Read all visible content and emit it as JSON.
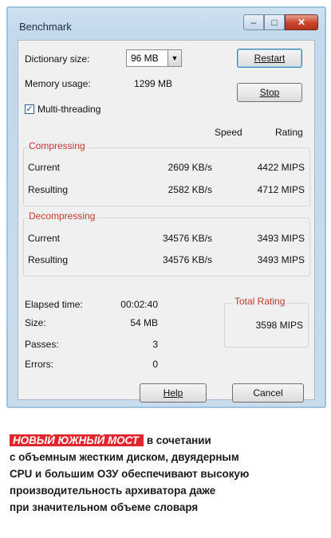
{
  "window": {
    "title": "Benchmark",
    "controls": [
      "minimize",
      "maximize",
      "close"
    ]
  },
  "form": {
    "dictionary_label": "Dictionary size:",
    "dictionary_value": "96 MB",
    "memory_label": "Memory usage:",
    "memory_value": "1299 MB",
    "multithreading_label": "Multi-threading",
    "multithreading_checked": true,
    "restart_label": "Restart",
    "stop_label": "Stop"
  },
  "columns": {
    "speed": "Speed",
    "rating": "Rating"
  },
  "compressing": {
    "title": "Compressing",
    "rows": [
      {
        "label": "Current",
        "speed": "2609 KB/s",
        "rating": "4422 MIPS"
      },
      {
        "label": "Resulting",
        "speed": "2582 KB/s",
        "rating": "4712 MIPS"
      }
    ]
  },
  "decompressing": {
    "title": "Decompressing",
    "rows": [
      {
        "label": "Current",
        "speed": "34576 KB/s",
        "rating": "3493 MIPS"
      },
      {
        "label": "Resulting",
        "speed": "34576 KB/s",
        "rating": "3493 MIPS"
      }
    ]
  },
  "stats": [
    {
      "label": "Elapsed time:",
      "value": "00:02:40"
    },
    {
      "label": "Size:",
      "value": "54 MB"
    },
    {
      "label": "Passes:",
      "value": "3"
    },
    {
      "label": "Errors:",
      "value": "0"
    }
  ],
  "total": {
    "title": "Total Rating",
    "value": "3598 MIPS"
  },
  "buttons": {
    "help": "Help",
    "cancel": "Cancel"
  },
  "caption": {
    "tag": "НОВЫЙ ЮЖНЫЙ МОСТ",
    "text1": "в сочетании",
    "line2": "с объемным жестким диском, двуядерным",
    "line3": "CPU и большим ОЗУ обеспечивают высокую",
    "line4": "производительность архиватора даже",
    "line5": "при значительном объеме словаря"
  },
  "colors": {
    "accent_red": "#e2262d",
    "group_title": "#c0392b",
    "frame": "#9ec3dd"
  }
}
